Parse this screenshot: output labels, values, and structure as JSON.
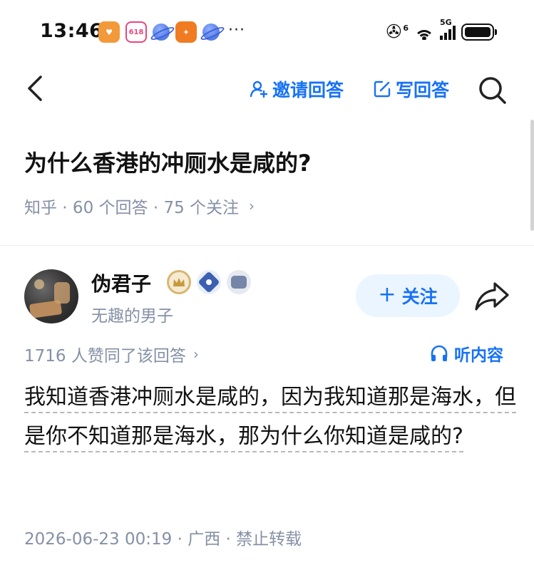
{
  "status_bar": {
    "time": "13:46",
    "app_icons": [
      "heart-app-icon",
      "618-app-icon",
      "planet-icon",
      "orange-app-icon",
      "planet-icon"
    ],
    "more": "···",
    "network_small": "6",
    "network_type": "5G",
    "battery_level": 1.0
  },
  "nav": {
    "back": "back-icon",
    "invite_label": "邀请回答",
    "write_label": "写回答",
    "search": "search-icon"
  },
  "question": {
    "title": "为什么香港的冲厕水是咸的?",
    "meta": "知乎 · 60 个回答 · 75 个关注",
    "meta_chevron": "›"
  },
  "author": {
    "name": "伪君子",
    "bio": "无趣的男子",
    "follow_plus": "+",
    "follow_label": "关注"
  },
  "answer_meta": {
    "votes": "1716 人赞同了该回答",
    "votes_chevron": "›",
    "listen_label": "听内容"
  },
  "answer": {
    "text": "我知道香港冲厕水是咸的，因为我知道那是海水，但是你不知道那是海水，那为什么你知道是咸的?"
  },
  "footer": {
    "info": "2026-06-23 00:19 · 广西 · 禁止转载"
  },
  "colors": {
    "accent": "#1772f6",
    "muted": "#8590a6",
    "follow_bg": "#ebf5ff"
  }
}
